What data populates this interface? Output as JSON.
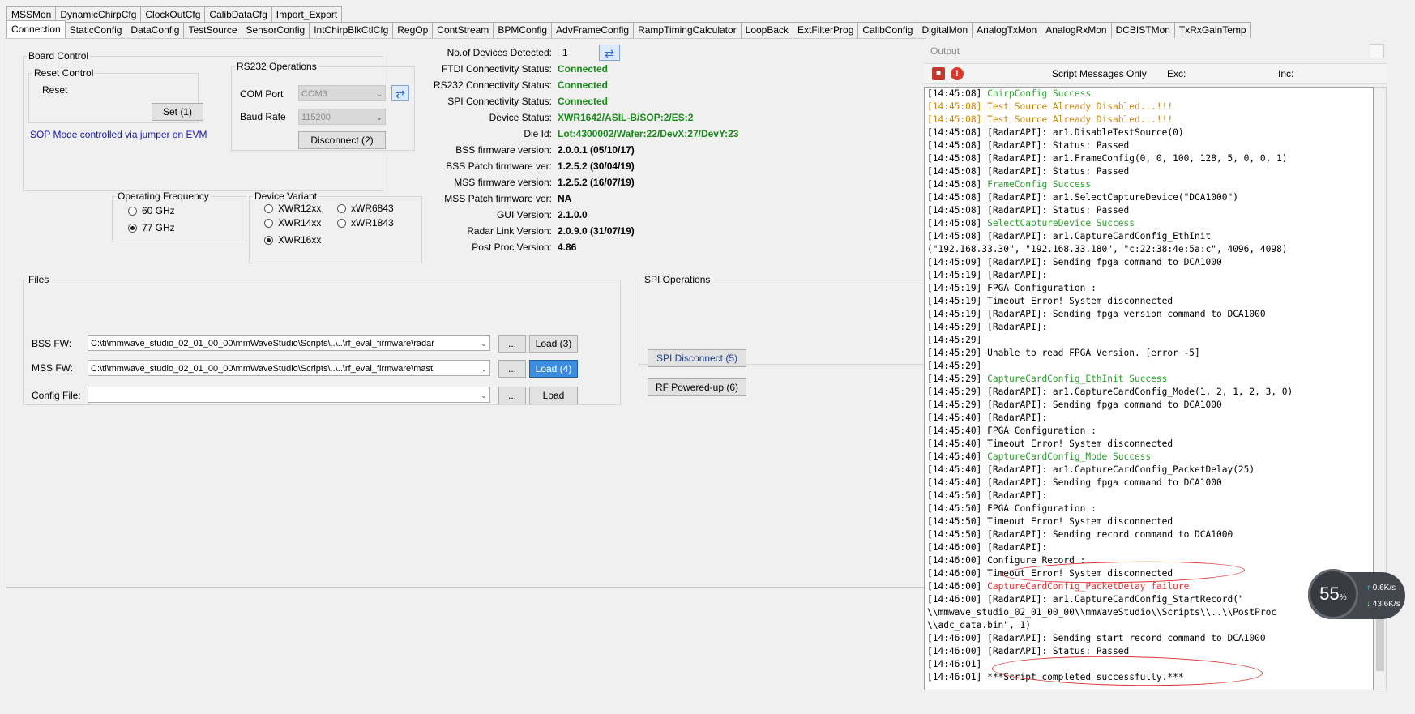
{
  "top_tabs": [
    "MSSMon",
    "DynamicChirpCfg",
    "ClockOutCfg",
    "CalibDataCfg",
    "Import_Export"
  ],
  "sub_tabs": [
    "Connection",
    "StaticConfig",
    "DataConfig",
    "TestSource",
    "SensorConfig",
    "IntChirpBlkCtlCfg",
    "RegOp",
    "ContStream",
    "BPMConfig",
    "AdvFrameConfig",
    "RampTimingCalculator",
    "LoopBack",
    "ExtFilterProg",
    "CalibConfig",
    "DigitalMon",
    "AnalogTxMon",
    "AnalogRxMon",
    "DCBISTMon",
    "TxRxGainTemp"
  ],
  "board_control": {
    "title": "Board Control",
    "reset_control": {
      "title": "Reset Control",
      "label": "Reset",
      "button": "Set (1)"
    },
    "sop_note": "SOP Mode controlled via jumper on EVM"
  },
  "rs232": {
    "title": "RS232 Operations",
    "com_port_label": "COM Port",
    "com_port_value": "COM3",
    "baud_label": "Baud Rate",
    "baud_value": "115200",
    "disconnect_button": "Disconnect (2)"
  },
  "operating_frequency": {
    "title": "Operating Frequency",
    "options": [
      "60 GHz",
      "77 GHz"
    ],
    "selected": "77 GHz"
  },
  "device_variant": {
    "title": "Device Variant",
    "options": [
      "XWR12xx",
      "xWR6843",
      "XWR14xx",
      "xWR1843",
      "XWR16xx"
    ],
    "selected": "XWR16xx"
  },
  "status": {
    "devices_label": "No.of Devices Detected:",
    "devices_value": "1",
    "ftdi_label": "FTDI Connectivity Status:",
    "ftdi_value": "Connected",
    "rs232_label": "RS232 Connectivity Status:",
    "rs232_value": "Connected",
    "spi_label": "SPI Connectivity Status:",
    "spi_value": "Connected",
    "device_label": "Device Status:",
    "device_value": "XWR1642/ASIL-B/SOP:2/ES:2",
    "dieid_label": "Die Id:",
    "dieid_value": "Lot:4300002/Wafer:22/DevX:27/DevY:23",
    "bss_fw_label": "BSS firmware version:",
    "bss_fw_value": "2.0.0.1 (05/10/17)",
    "bss_patch_label": "BSS Patch firmware ver:",
    "bss_patch_value": "1.2.5.2 (30/04/19)",
    "mss_fw_label": "MSS firmware version:",
    "mss_fw_value": "1.2.5.2 (16/07/19)",
    "mss_patch_label": "MSS Patch firmware ver:",
    "mss_patch_value": "NA",
    "gui_label": "GUI Version:",
    "gui_value": "2.1.0.0",
    "radarlink_label": "Radar Link Version:",
    "radarlink_value": "2.0.9.0 (31/07/19)",
    "postproc_label": "Post Proc Version:",
    "postproc_value": "4.86"
  },
  "files": {
    "title": "Files",
    "bss_label": "BSS FW:",
    "bss_path": "C:\\ti\\mmwave_studio_02_01_00_00\\mmWaveStudio\\Scripts\\..\\..\\rf_eval_firmware\\radar",
    "mss_label": "MSS FW:",
    "mss_path": "C:\\ti\\mmwave_studio_02_01_00_00\\mmWaveStudio\\Scripts\\..\\..\\rf_eval_firmware\\mast",
    "config_label": "Config File:",
    "config_path": "",
    "browse": "...",
    "load_bss": "Load (3)",
    "load_mss": "Load (4)",
    "load_config": "Load"
  },
  "spi_ops": {
    "title": "SPI Operations",
    "disconnect": "SPI Disconnect (5)",
    "rf_powered": "RF Powered-up (6)"
  },
  "output": {
    "title": "Output",
    "filter": "Script Messages Only",
    "exc_label": "Exc:",
    "inc_label": "Inc:",
    "lines": [
      {
        "ts": "[14:45:08]",
        "msg": " ChirpConfig Success",
        "c": "gn"
      },
      {
        "ts": "[14:45:08]",
        "msg": " Test Source Already Disabled...!!!",
        "c": "y"
      },
      {
        "ts": "[14:45:08]",
        "msg": " Test Source Already Disabled...!!!",
        "c": "y"
      },
      {
        "ts": "[14:45:08]",
        "msg": " [RadarAPI]: ar1.DisableTestSource(0)",
        "c": ""
      },
      {
        "ts": "[14:45:08]",
        "msg": " [RadarAPI]: Status: Passed",
        "c": ""
      },
      {
        "ts": "[14:45:08]",
        "msg": " [RadarAPI]: ar1.FrameConfig(0, 0, 100, 128, 5, 0, 0, 1)",
        "c": ""
      },
      {
        "ts": "[14:45:08]",
        "msg": " [RadarAPI]: Status: Passed",
        "c": ""
      },
      {
        "ts": "[14:45:08]",
        "msg": " FrameConfig Success",
        "c": "gn"
      },
      {
        "ts": "[14:45:08]",
        "msg": " [RadarAPI]: ar1.SelectCaptureDevice(\"DCA1000\")",
        "c": ""
      },
      {
        "ts": "[14:45:08]",
        "msg": " [RadarAPI]: Status: Passed",
        "c": ""
      },
      {
        "ts": "[14:45:08]",
        "msg": " SelectCaptureDevice Success",
        "c": "gn"
      },
      {
        "ts": "[14:45:08]",
        "msg": " [RadarAPI]: ar1.CaptureCardConfig_EthInit",
        "c": ""
      },
      {
        "ts": "",
        "msg": "(\"192.168.33.30\", \"192.168.33.180\", \"c:22:38:4e:5a:c\", 4096, 4098)",
        "c": ""
      },
      {
        "ts": "[14:45:09]",
        "msg": " [RadarAPI]: Sending fpga command to DCA1000",
        "c": ""
      },
      {
        "ts": "[14:45:19]",
        "msg": " [RadarAPI]:",
        "c": ""
      },
      {
        "ts": "[14:45:19]",
        "msg": " FPGA Configuration :",
        "c": ""
      },
      {
        "ts": "[14:45:19]",
        "msg": " Timeout Error! System disconnected",
        "c": ""
      },
      {
        "ts": "[14:45:19]",
        "msg": " [RadarAPI]: Sending fpga_version command to DCA1000",
        "c": ""
      },
      {
        "ts": "[14:45:29]",
        "msg": " [RadarAPI]:",
        "c": ""
      },
      {
        "ts": "[14:45:29]",
        "msg": "",
        "c": ""
      },
      {
        "ts": "[14:45:29]",
        "msg": " Unable to read FPGA Version. [error -5]",
        "c": ""
      },
      {
        "ts": "[14:45:29]",
        "msg": "",
        "c": ""
      },
      {
        "ts": "[14:45:29]",
        "msg": " CaptureCardConfig_EthInit Success",
        "c": "gn"
      },
      {
        "ts": "[14:45:29]",
        "msg": " [RadarAPI]: ar1.CaptureCardConfig_Mode(1, 2, 1, 2, 3, 0)",
        "c": ""
      },
      {
        "ts": "[14:45:29]",
        "msg": " [RadarAPI]: Sending fpga command to DCA1000",
        "c": ""
      },
      {
        "ts": "[14:45:40]",
        "msg": " [RadarAPI]:",
        "c": ""
      },
      {
        "ts": "[14:45:40]",
        "msg": " FPGA Configuration :",
        "c": ""
      },
      {
        "ts": "[14:45:40]",
        "msg": " Timeout Error! System disconnected",
        "c": ""
      },
      {
        "ts": "[14:45:40]",
        "msg": " CaptureCardConfig_Mode Success",
        "c": "gn"
      },
      {
        "ts": "[14:45:40]",
        "msg": " [RadarAPI]: ar1.CaptureCardConfig_PacketDelay(25)",
        "c": ""
      },
      {
        "ts": "[14:45:40]",
        "msg": " [RadarAPI]: Sending fpga command to DCA1000",
        "c": ""
      },
      {
        "ts": "[14:45:50]",
        "msg": " [RadarAPI]:",
        "c": ""
      },
      {
        "ts": "[14:45:50]",
        "msg": " FPGA Configuration :",
        "c": ""
      },
      {
        "ts": "[14:45:50]",
        "msg": " Timeout Error! System disconnected",
        "c": ""
      },
      {
        "ts": "[14:45:50]",
        "msg": " [RadarAPI]: Sending record command to DCA1000",
        "c": ""
      },
      {
        "ts": "[14:46:00]",
        "msg": " [RadarAPI]:",
        "c": ""
      },
      {
        "ts": "[14:46:00]",
        "msg": " Configure Record :",
        "c": ""
      },
      {
        "ts": "[14:46:00]",
        "msg": " Timeout Error! System disconnected",
        "c": ""
      },
      {
        "ts": "[14:46:00]",
        "msg": " CaptureCardConfig_PacketDelay failure",
        "c": "r"
      },
      {
        "ts": "[14:46:00]",
        "msg": " [RadarAPI]: ar1.CaptureCardConfig_StartRecord(\"",
        "c": ""
      },
      {
        "ts": "",
        "msg": "\\\\mmwave_studio_02_01_00_00\\\\mmWaveStudio\\\\Scripts\\\\..\\\\PostProc",
        "c": ""
      },
      {
        "ts": "",
        "msg": "\\\\adc_data.bin\", 1)",
        "c": ""
      },
      {
        "ts": "[14:46:00]",
        "msg": " [RadarAPI]: Sending start_record command to DCA1000",
        "c": ""
      },
      {
        "ts": "[14:46:00]",
        "msg": " [RadarAPI]: Status: Passed",
        "c": ""
      },
      {
        "ts": "[14:46:01]",
        "msg": "",
        "c": ""
      },
      {
        "ts": "[14:46:01]",
        "msg": " ***Script completed successfully.***",
        "c": ""
      }
    ]
  },
  "net_overlay": {
    "percent": "55",
    "percent_unit": "%",
    "up": "0.6K/s",
    "down": "43.6K/s"
  },
  "colors": {
    "green_status": "#1a8a1a",
    "log_green": "#2a9d2a",
    "log_yellow": "#c68a00",
    "log_red": "#e03030",
    "selected_button": "#3c8de0"
  }
}
